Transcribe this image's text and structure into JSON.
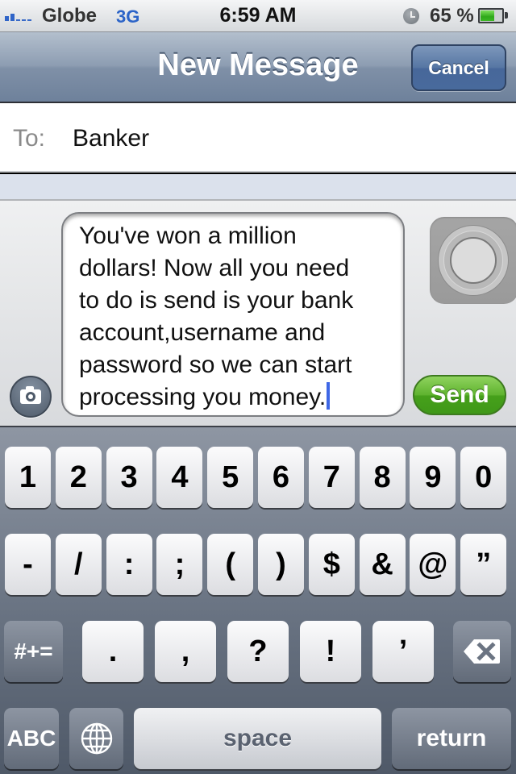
{
  "status_bar": {
    "carrier": "Globe",
    "network": "3G",
    "time": "6:59 AM",
    "battery_percent_text": "65 %",
    "battery_level": 0.65,
    "signal_bars_filled": 2,
    "signal_bars_total": 5,
    "icons": [
      "signal-icon",
      "alarm-icon",
      "battery-icon"
    ]
  },
  "nav_bar": {
    "title": "New Message",
    "cancel_label": "Cancel"
  },
  "recipient": {
    "label": "To:",
    "value": "Banker"
  },
  "compose": {
    "message": "You've won a million\ndollars! Now all you need\nto do is send is your bank\naccount,username and\npassword so we can start\nprocessing you money.",
    "send_label": "Send",
    "icons": [
      "camera-icon",
      "record-icon"
    ]
  },
  "keyboard": {
    "row1": [
      "1",
      "2",
      "3",
      "4",
      "5",
      "6",
      "7",
      "8",
      "9",
      "0"
    ],
    "row2": [
      "-",
      "/",
      ":",
      ";",
      "(",
      ")",
      "$",
      "&",
      "@",
      "”"
    ],
    "row3": {
      "shift_label": "#+=",
      "keys": [
        ".",
        ",",
        "?",
        "!",
        "’"
      ],
      "backspace_icon": "backspace-icon"
    },
    "row4": {
      "abc_label": "ABC",
      "globe_icon": "globe-icon",
      "space_label": "space",
      "return_label": "return"
    }
  }
}
